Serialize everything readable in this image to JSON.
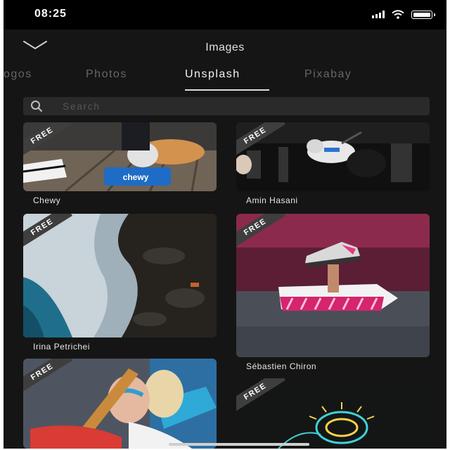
{
  "status_bar": {
    "time": "08:25"
  },
  "header": {
    "title": "Images"
  },
  "tabs": [
    {
      "label": "ogos"
    },
    {
      "label": "Photos"
    },
    {
      "label": "Unsplash"
    },
    {
      "label": "Pixabay"
    }
  ],
  "active_tab": "Unsplash",
  "search": {
    "placeholder": "Search"
  },
  "images": [
    {
      "badge": "FREE",
      "author": "Chewy"
    },
    {
      "badge": "FREE",
      "author": "Amin Hasani"
    },
    {
      "badge": "FREE",
      "author": "Irina Petrichei"
    },
    {
      "badge": "FREE",
      "author": "Sébastien Chiron"
    },
    {
      "badge": "FREE",
      "author": ""
    },
    {
      "badge": "FREE",
      "author": ""
    }
  ],
  "dog_box_label": "chewy",
  "colors": {
    "background": "#151515",
    "accent_shoe_box": "#d6246e"
  }
}
